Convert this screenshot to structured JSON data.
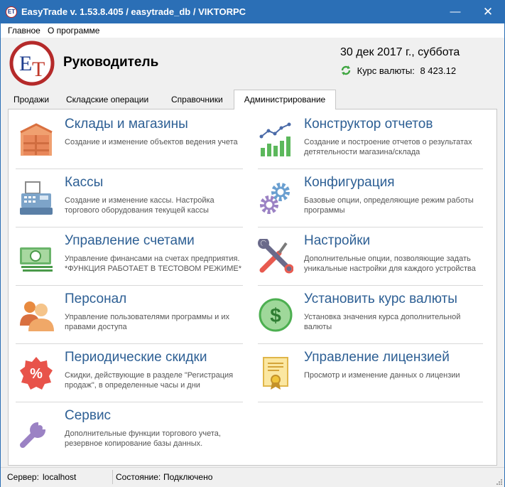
{
  "window": {
    "title": "EasyTrade v. 1.53.8.405 / easytrade_db / VIKTORPC",
    "minimize": "—",
    "close": "✕"
  },
  "menu": [
    "Главное",
    "О программе"
  ],
  "header": {
    "role": "Руководитель",
    "date": "30 дек 2017 г., суббота",
    "rate_label": "Курс валюты:",
    "rate_value": "8 423.12"
  },
  "tabs": {
    "items": [
      "Продажи",
      "Складские операции",
      "Справочники"
    ],
    "active": "Администрирование"
  },
  "cards": [
    {
      "title": "Склады и магазины",
      "desc": "Создание и изменение объектов ведения учета",
      "icon": "warehouse-icon"
    },
    {
      "title": "Конструктор отчетов",
      "desc": "Создание и построение отчетов о результатах детятельности магазина/склада",
      "icon": "report-chart-icon"
    },
    {
      "title": "Кассы",
      "desc": "Создание и изменение кассы. Настройка торгового оборудования текущей кассы",
      "icon": "cash-register-icon"
    },
    {
      "title": "Конфигурация",
      "desc": "Базовые опции, определяющие режим работы программы",
      "icon": "gears-icon"
    },
    {
      "title": "Управление счетами",
      "desc": "Управление финансами на счетах предприятия. *ФУНКЦИЯ РАБОТАЕТ В ТЕСТОВОМ РЕЖИМЕ*",
      "icon": "banknotes-icon"
    },
    {
      "title": "Настройки",
      "desc": "Дополнительные опции, позволяющие задать уникальные настройки для каждого устройства",
      "icon": "tools-icon"
    },
    {
      "title": "Персонал",
      "desc": "Управление пользователями программы и их правами доступа",
      "icon": "users-icon"
    },
    {
      "title": "Установить курс валюты",
      "desc": "Установка значения курса дополнительной валюты",
      "icon": "dollar-coin-icon"
    },
    {
      "title": "Периодические скидки",
      "desc": "Скидки, действующие в разделе \"Регистрация продаж\", в определенные часы и дни",
      "icon": "discount-badge-icon"
    },
    {
      "title": "Управление лицензией",
      "desc": "Просмотр и изменение данных о лицензии",
      "icon": "certificate-icon"
    },
    {
      "title": "Сервис",
      "desc": "Дополнительные функции торгового учета, резервное копирование базы данных.",
      "icon": "wrench-icon"
    }
  ],
  "status": {
    "server_label": "Сервер:",
    "server_value": "localhost",
    "state_label": "Состояние:",
    "state_value": "Подключено"
  },
  "colors": {
    "titlebar": "#2b6fb6",
    "card_title": "#2d5f94",
    "accent_red": "#e8534a",
    "accent_green": "#4caf50"
  }
}
